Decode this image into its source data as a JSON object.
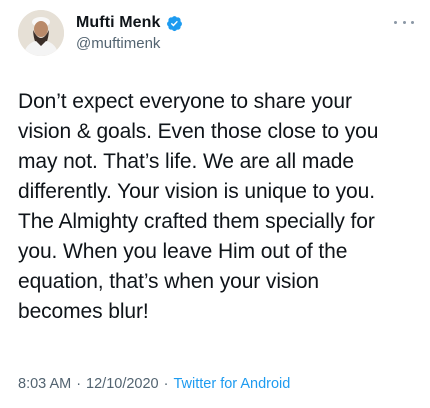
{
  "author": {
    "display_name": "Mufti Menk",
    "handle": "@muftimenk",
    "verified": true
  },
  "tweet": {
    "text": "Don’t expect everyone to share your\nvision & goals. Even those close to you\nmay not. That’s life. We are all made\ndifferently. Your vision is unique to you.\nThe Almighty crafted them specially for\nyou. When you leave Him out of the\nequation, that’s when your vision\nbecomes blur!",
    "time": "8:03 AM",
    "separator": "·",
    "date": "12/10/2020",
    "source": "Twitter for Android"
  },
  "icons": {
    "verified": "verified-badge-icon",
    "more": "more-options-icon"
  },
  "colors": {
    "accent": "#1d9bf0",
    "text": "#0f1419",
    "secondary": "#536471"
  }
}
